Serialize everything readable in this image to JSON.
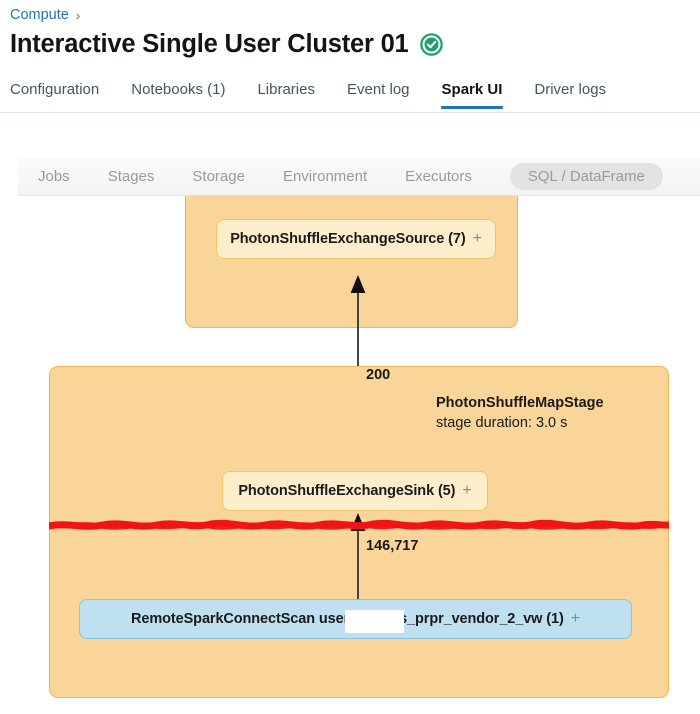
{
  "breadcrumb": {
    "items": [
      "Compute"
    ],
    "separator": "›"
  },
  "header": {
    "title": "Interactive Single User Cluster 01",
    "status_icon": "check-circle-icon",
    "status_color": "#22a06b"
  },
  "tabs": [
    {
      "label": "Configuration",
      "active": false
    },
    {
      "label": "Notebooks (1)",
      "active": false
    },
    {
      "label": "Libraries",
      "active": false
    },
    {
      "label": "Event log",
      "active": false
    },
    {
      "label": "Spark UI",
      "active": true
    },
    {
      "label": "Driver logs",
      "active": false
    }
  ],
  "tab_accent_color": "#2272b4",
  "spark_ui": {
    "subtabs": [
      {
        "label": "Jobs",
        "selected": false
      },
      {
        "label": "Stages",
        "selected": false
      },
      {
        "label": "Storage",
        "selected": false
      },
      {
        "label": "Environment",
        "selected": false
      },
      {
        "label": "Executors",
        "selected": false
      },
      {
        "label": "SQL / DataFrame",
        "selected": true
      }
    ],
    "dag": {
      "stage_fill_color": "#f9d59a",
      "stage_border_color": "#eeb44f",
      "node_orange_fill": "#fdeecb",
      "node_blue_fill": "#bfe0f0",
      "stages": [
        {
          "name": "",
          "duration": ""
        },
        {
          "name": "PhotonShuffleMapStage",
          "duration": "stage duration: 3.0 s"
        }
      ],
      "nodes": [
        {
          "label": "PhotonShuffleExchangeSource (7)",
          "expand": "+"
        },
        {
          "label": "PhotonShuffleExchangeSink (5)",
          "expand": "+"
        },
        {
          "label_prefix": "RemoteSparkConnectScan users.ja",
          "label_suffix": "nd.fs_prpr_vendor_2_vw (1)",
          "expand": "+"
        }
      ],
      "edge_labels": [
        "200",
        "146,717"
      ],
      "annotation_color": "#f01414"
    }
  }
}
